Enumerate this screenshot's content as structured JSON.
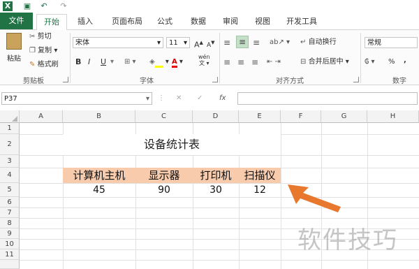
{
  "quick_access": [
    "X",
    "💾",
    "↶",
    "↷"
  ],
  "tabs": [
    {
      "label": "文件"
    },
    {
      "label": "开始"
    },
    {
      "label": "插入"
    },
    {
      "label": "页面布局"
    },
    {
      "label": "公式"
    },
    {
      "label": "数据"
    },
    {
      "label": "审阅"
    },
    {
      "label": "视图"
    },
    {
      "label": "开发工具"
    }
  ],
  "ribbon": {
    "clipboard": {
      "paste": "粘贴",
      "cut": "剪切",
      "copy": "复制",
      "format_painter": "格式刷",
      "label": "剪贴板"
    },
    "font": {
      "name": "宋体",
      "size": "11",
      "label": "字体",
      "bold": "B",
      "italic": "I",
      "underline": "U",
      "wen": "wén"
    },
    "alignment": {
      "wrap": "自动换行",
      "merge": "合并后居中",
      "label": "对齐方式"
    },
    "number": {
      "format": "常规",
      "percent": "%",
      "comma": ",",
      "label": "数字"
    }
  },
  "formula_bar": {
    "name_box": "P37",
    "fx": "fx",
    "cancel": "✕",
    "confirm": "✓"
  },
  "columns": [
    "A",
    "B",
    "C",
    "D",
    "E",
    "F",
    "G",
    "H"
  ],
  "rows": [
    "1",
    "2",
    "3",
    "4",
    "5",
    "6",
    "7",
    "8",
    "9",
    "10",
    "11"
  ],
  "sheet": {
    "title": "设备统计表",
    "headers": [
      "计算机主机",
      "显示器",
      "打印机",
      "扫描仪"
    ],
    "values": [
      "45",
      "90",
      "30",
      "12"
    ]
  },
  "watermark": "软件技巧",
  "colors": {
    "excel_green": "#217346",
    "header_fill": "#f8cbad",
    "arrow": "#e8782e"
  }
}
